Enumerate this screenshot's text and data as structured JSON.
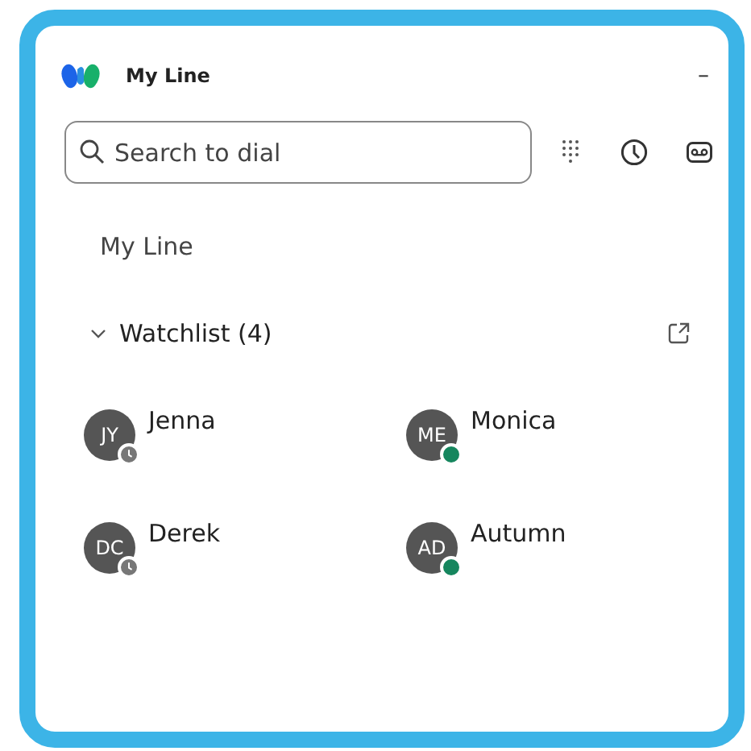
{
  "window": {
    "title": "My Line",
    "minimize": "–"
  },
  "search": {
    "placeholder": "Search to dial"
  },
  "section_label": "My Line",
  "watchlist": {
    "label": "Watchlist (4)",
    "expanded": true,
    "contacts": [
      {
        "initials": "JY",
        "name": "Jenna",
        "available": false
      },
      {
        "initials": "ME",
        "name": "Monica",
        "available": true
      },
      {
        "initials": "DC",
        "name": "Derek",
        "available": false
      },
      {
        "initials": "AD",
        "name": "Autumn",
        "available": true
      }
    ]
  }
}
